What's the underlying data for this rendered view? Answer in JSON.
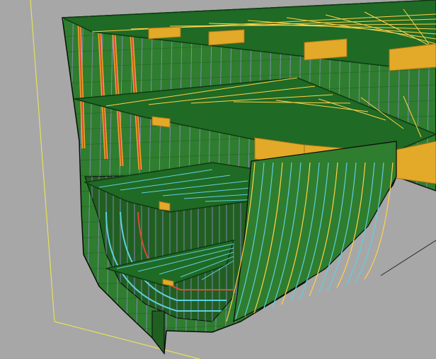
{
  "viewport": {
    "background": "#a7a7a7",
    "frame_line_color": "#e8e05a",
    "axis_line_color": "#2b2b2b"
  },
  "model": {
    "hull_plate_color": "#2f7d2f",
    "hull_plate_dark": "#215f21",
    "deck_color": "#1f6a24",
    "deck_edge_color": "#0f3a12",
    "girder_color": "#e3a928",
    "girder_edge": "#a8721a",
    "longitudinal_color": "#ffd24a",
    "frame_color": "#9a8fd8",
    "stiffener_color": "#5fd0e0",
    "web_frame_color": "#e0483a",
    "outline_color": "#0a0a0a"
  }
}
